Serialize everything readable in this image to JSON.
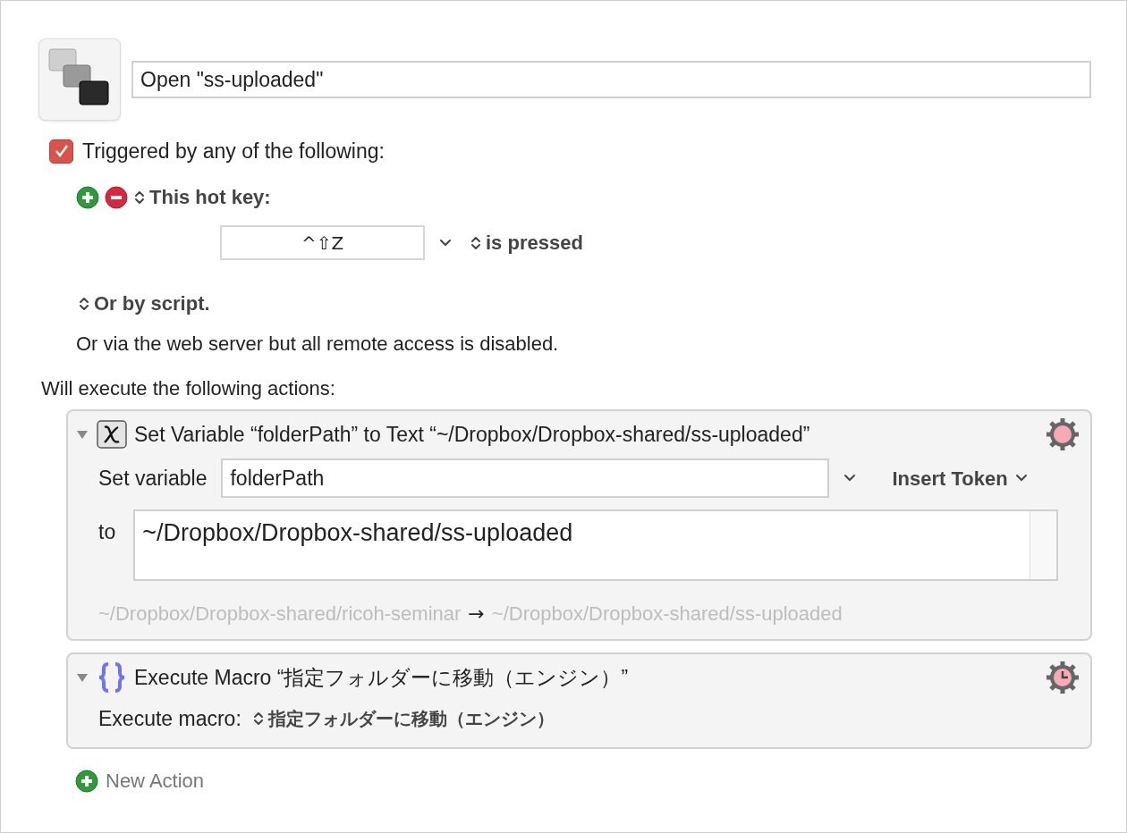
{
  "macro": {
    "name": "Open \"ss-uploaded\""
  },
  "trigger": {
    "checked": true,
    "label": "Triggered by any of the following:"
  },
  "hotkey": {
    "label": "This hot key:",
    "keys": "^⇧Z",
    "condition": "is pressed"
  },
  "script_trigger": {
    "label": "Or by script."
  },
  "web_note": "Or via the web server but all remote access is disabled.",
  "actions_heading": "Will execute the following actions:",
  "actions": [
    {
      "kind": "set_variable",
      "expanded": true,
      "title": "Set Variable “folderPath” to Text “~/Dropbox/Dropbox-shared/ss-uploaded”",
      "variable_label": "Set variable",
      "variable": "folderPath",
      "token_menu": "Insert Token",
      "to_label": "to",
      "text": "~/Dropbox/Dropbox-shared/ss-uploaded",
      "preview_before": "~/Dropbox/Dropbox-shared/ricoh-seminar",
      "preview_arrow": "→",
      "preview_after": "~/Dropbox/Dropbox-shared/ss-uploaded"
    },
    {
      "kind": "execute_macro",
      "expanded": true,
      "title": "Execute Macro “指定フォルダーに移動（エンジン）”",
      "macro_label": "Execute macro:",
      "macro": "指定フォルダーに移動（エンジン）"
    }
  ],
  "new_action": "New Action"
}
